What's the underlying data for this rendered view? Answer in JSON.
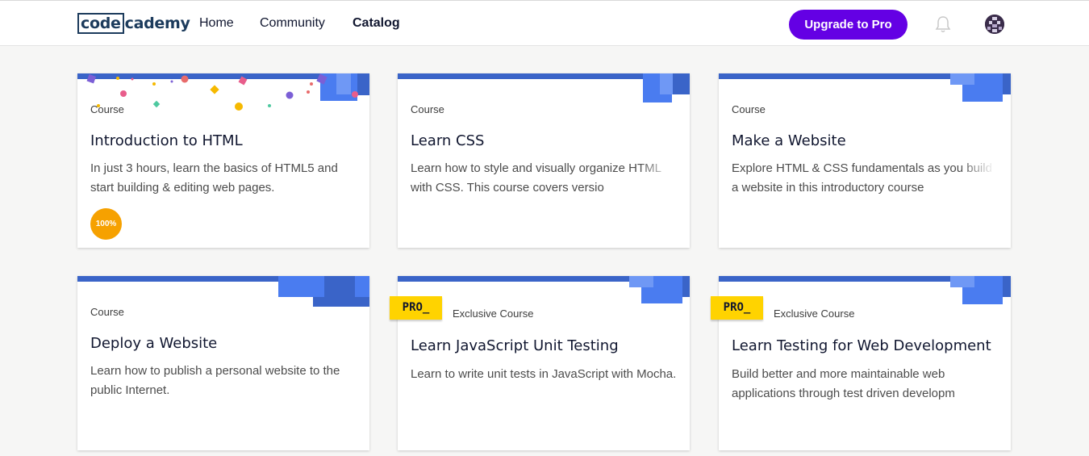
{
  "header": {
    "logo_box": "code",
    "logo_rest": "cademy",
    "nav": [
      "Home",
      "Community",
      "Catalog"
    ],
    "active_nav": "Catalog",
    "upgrade_label": "Upgrade to Pro"
  },
  "colors": {
    "accent": "#6400e4",
    "card_stripe": "#3a64c8",
    "pro_badge": "#ffd300",
    "progress": "#f6a100"
  },
  "cards": [
    {
      "type": "Course",
      "title": "Introduction to HTML",
      "desc": "In just 3 hours, learn the basics of HTML5 and start building & editing web pages.",
      "progress_label": "100%"
    },
    {
      "type": "Course",
      "title": "Learn CSS",
      "desc": "Learn how to style and visually organize HTML with CSS. This course covers versio"
    },
    {
      "type": "Course",
      "title": "Make a Website",
      "desc": "Explore HTML & CSS fundamentals as you build a website in this introductory course"
    },
    {
      "type": "Course",
      "title": "Deploy a Website",
      "desc": "Learn how to publish a personal website to the public Internet."
    },
    {
      "badge": "PRO_",
      "type": "Exclusive Course",
      "title": "Learn JavaScript Unit Testing",
      "desc": "Learn to write unit tests in JavaScript with Mocha."
    },
    {
      "badge": "PRO_",
      "type": "Exclusive Course",
      "title": "Learn Testing for Web Development",
      "desc": "Build better and more maintainable web applications through test driven developm"
    }
  ],
  "icons": {
    "bell": "bell-icon",
    "avatar": "user-avatar"
  }
}
